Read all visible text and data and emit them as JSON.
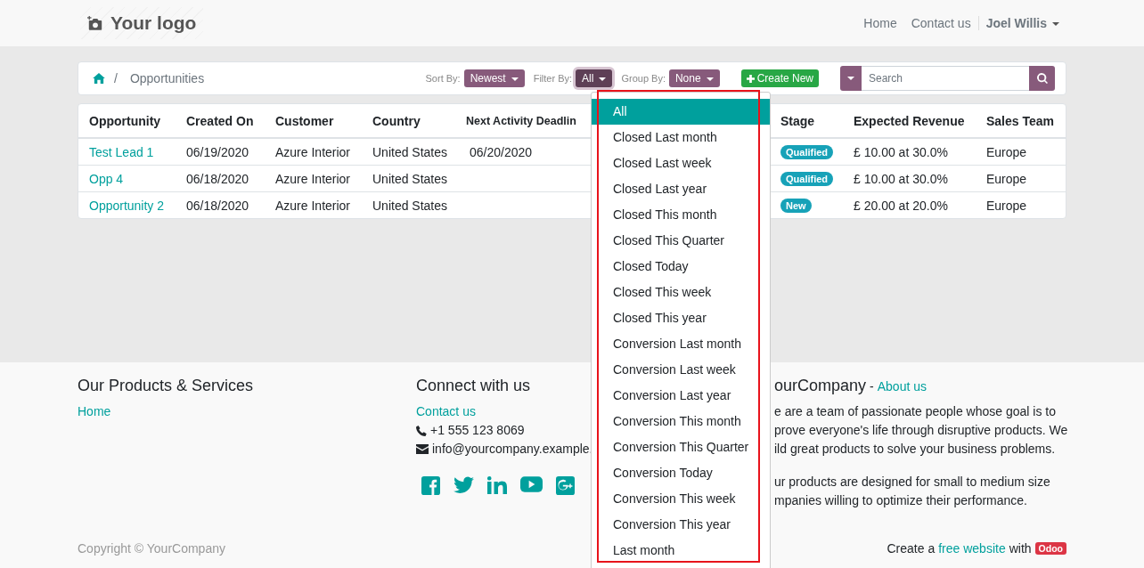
{
  "header": {
    "logo": "Your logo",
    "nav": [
      {
        "label": "Home"
      },
      {
        "label": "Contact us"
      }
    ],
    "user": "Joel Willis"
  },
  "breadcrumb": {
    "separator": "/",
    "current": "Opportunities"
  },
  "controls": {
    "sort": {
      "label": "Sort By:",
      "value": "Newest"
    },
    "filter": {
      "label": "Filter By:",
      "value": "All",
      "expanded": true
    },
    "group": {
      "label": "Group By:",
      "value": "None"
    },
    "create": "Create New",
    "search": {
      "placeholder": "Search"
    }
  },
  "table": {
    "columns": [
      "Opportunity",
      "Created On",
      "Customer",
      "Country",
      "Next Activity Deadlin",
      "Stage",
      "Expected Revenue",
      "Sales Team"
    ],
    "rows": [
      {
        "opportunity": "Test Lead 1",
        "created_on": "06/19/2020",
        "customer": "Azure Interior",
        "country": "United States",
        "next_activity": "06/20/2020",
        "stage": "Qualified",
        "expected_revenue": "£ 10.00 at 30.0%",
        "sales_team": "Europe"
      },
      {
        "opportunity": "Opp 4",
        "created_on": "06/18/2020",
        "customer": "Azure Interior",
        "country": "United States",
        "stage": "Qualified",
        "expected_revenue": "£ 10.00 at 30.0%",
        "sales_team": "Europe"
      },
      {
        "opportunity": "Opportunity 2",
        "created_on": "06/18/2020",
        "customer": "Azure Interior",
        "country": "United States",
        "stage": "New",
        "expected_revenue": "£ 20.00 at 20.0%",
        "sales_team": "Europe"
      }
    ]
  },
  "filter_menu": {
    "items": [
      {
        "label": "All",
        "selected": true
      },
      {
        "label": "Closed Last month",
        "selected": false
      },
      {
        "label": "Closed Last week",
        "selected": false
      },
      {
        "label": "Closed Last year",
        "selected": false
      },
      {
        "label": "Closed This month",
        "selected": false
      },
      {
        "label": "Closed This Quarter",
        "selected": false
      },
      {
        "label": "Closed Today",
        "selected": false
      },
      {
        "label": "Closed This week",
        "selected": false
      },
      {
        "label": "Closed This year",
        "selected": false
      },
      {
        "label": "Conversion Last month",
        "selected": false
      },
      {
        "label": "Conversion Last week",
        "selected": false
      },
      {
        "label": "Conversion Last year",
        "selected": false
      },
      {
        "label": "Conversion This month",
        "selected": false
      },
      {
        "label": "Conversion This Quarter",
        "selected": false
      },
      {
        "label": "Conversion Today",
        "selected": false
      },
      {
        "label": "Conversion This week",
        "selected": false
      },
      {
        "label": "Conversion This year",
        "selected": false
      },
      {
        "label": "Last month",
        "selected": false
      }
    ]
  },
  "footer": {
    "products": {
      "title": "Our Products & Services",
      "links": [
        "Home"
      ]
    },
    "connect": {
      "title": "Connect with us",
      "link": "Contact us",
      "phone": "+1 555 123 8069",
      "email": "info@yourcompany.example."
    },
    "about": {
      "title": "ourCompany",
      "separator": "-",
      "link": "About us",
      "paragraphs": [
        [
          "e are a team of passionate people whose goal is to",
          "prove everyone's life through disruptive products. We",
          "ild great products to solve your business problems."
        ],
        [
          "ur products are designed for small to medium size",
          "mpanies willing to optimize their performance."
        ]
      ]
    },
    "copyright": "Copyright © YourCompany",
    "credit": {
      "before": "Create a",
      "link": "free website",
      "after": "with",
      "brand": "Odoo"
    }
  }
}
